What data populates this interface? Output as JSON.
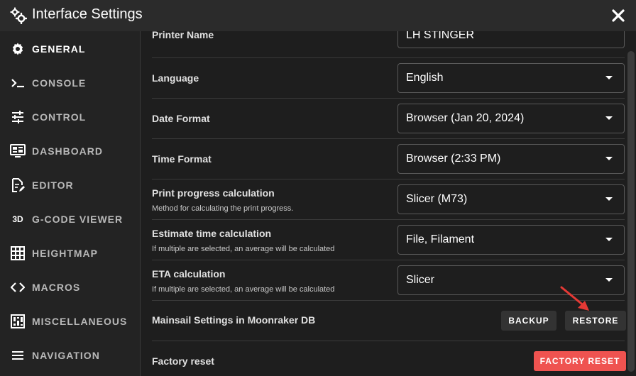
{
  "window": {
    "title": "Interface Settings",
    "title_icon": "cogs-icon",
    "close_icon": "close-icon"
  },
  "sidebar": {
    "items": [
      {
        "label": "GENERAL",
        "icon": "gear-icon",
        "active": true
      },
      {
        "label": "CONSOLE",
        "icon": "console-icon"
      },
      {
        "label": "CONTROL",
        "icon": "tune-icon"
      },
      {
        "label": "DASHBOARD",
        "icon": "monitor-dashboard-icon"
      },
      {
        "label": "EDITOR",
        "icon": "file-edit-icon"
      },
      {
        "label": "G-CODE VIEWER",
        "icon": "3d-icon",
        "icon_text": "3D"
      },
      {
        "label": "HEIGHTMAP",
        "icon": "grid-icon"
      },
      {
        "label": "MACROS",
        "icon": "code-brackets-icon"
      },
      {
        "label": "MISCELLANEOUS",
        "icon": "sliders-icon"
      },
      {
        "label": "NAVIGATION",
        "icon": "menu-icon"
      }
    ]
  },
  "settings": {
    "printer_name": {
      "label": "Printer Name",
      "value": "LH STINGER"
    },
    "language": {
      "label": "Language",
      "value": "English"
    },
    "date_format": {
      "label": "Date Format",
      "value": "Browser (Jan 20, 2024)"
    },
    "time_format": {
      "label": "Time Format",
      "value": "Browser (2:33 PM)"
    },
    "print_progress": {
      "label": "Print progress calculation",
      "sub": "Method for calculating the print progress.",
      "value": "Slicer (M73)"
    },
    "estimate_time": {
      "label": "Estimate time calculation",
      "sub": "If multiple are selected, an average will be calculated",
      "value": "File, Filament"
    },
    "eta": {
      "label": "ETA calculation",
      "sub": "If multiple are selected, an average will be calculated",
      "value": "Slicer"
    },
    "moonraker_db": {
      "label": "Mainsail Settings in Moonraker DB",
      "backup_label": "BACKUP",
      "restore_label": "RESTORE"
    },
    "factory_reset": {
      "label": "Factory reset",
      "button_label": "FACTORY RESET"
    }
  },
  "colors": {
    "accent_red": "#ef5350",
    "annotation_arrow": "#e53935"
  }
}
